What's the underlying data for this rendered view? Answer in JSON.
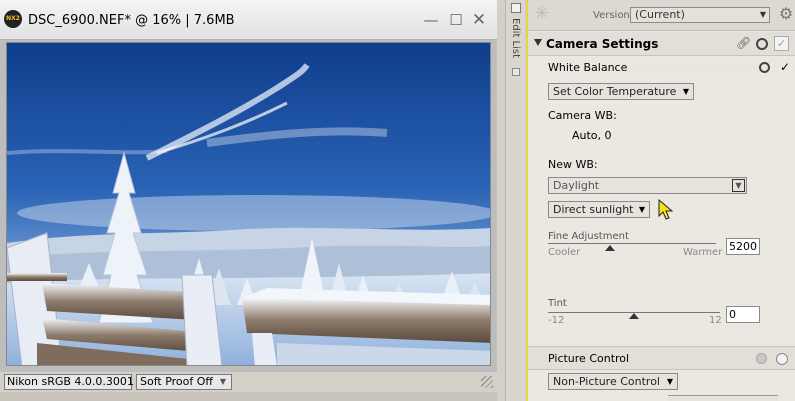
{
  "image_window": {
    "title": "DSC_6900.NEF* @ 16% | 7.6MB",
    "logo_text": "NX2",
    "color_profile": "Nikon sRGB 4.0.0.3001",
    "soft_proof": "Soft Proof Off"
  },
  "edit_list": {
    "label": "Edit List"
  },
  "panel": {
    "version_label": "Version",
    "version_value": "(Current)",
    "camera_settings": {
      "title": "Camera Settings",
      "white_balance": {
        "label": "White Balance",
        "method": "Set Color Temperature",
        "camera_wb_label": "Camera WB:",
        "camera_wb_value": "Auto, 0",
        "new_wb_label": "New WB:",
        "new_wb_value": "Daylight",
        "sub_preset": "Direct sunlight",
        "fine_adjustment": {
          "label": "Fine Adjustment",
          "min_label": "Cooler",
          "max_label": "Warmer",
          "value": "5200",
          "level": 0.37
        },
        "tint": {
          "label": "Tint",
          "min_label": "-12",
          "max_label": "12",
          "value": "0",
          "level": 0.5
        }
      }
    },
    "picture_control": {
      "label": "Picture Control",
      "value": "Non-Picture Control"
    }
  },
  "icons": {
    "sparkle": "sparkle-icon",
    "gear": "gear-icon",
    "link": "link-icon",
    "reset": "reset-icon",
    "check": "check-icon",
    "cursor": "cursor-icon"
  },
  "colors": {
    "panel_accent": "#e8d44a",
    "sky": "#1d4f9c",
    "cursor": "#f3e21a"
  }
}
